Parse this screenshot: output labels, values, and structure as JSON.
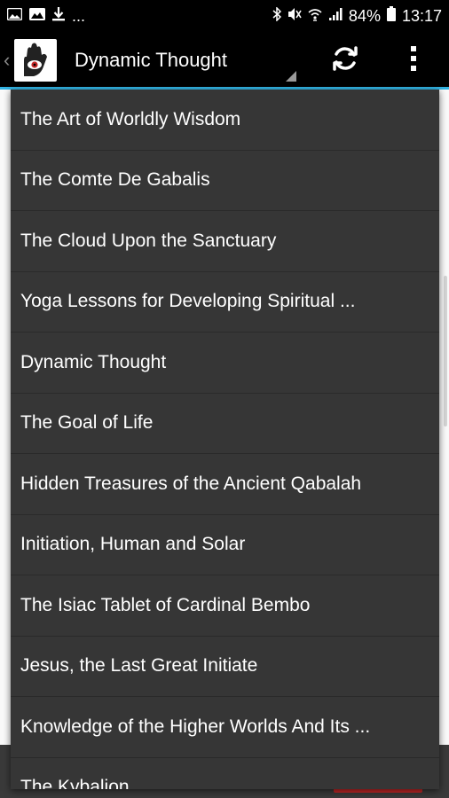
{
  "status_bar": {
    "battery_percent": "84%",
    "time": "13:17",
    "overflow_indicator": "...",
    "left_icons": [
      "image-icon",
      "gallery-icon",
      "download-icon"
    ],
    "right_icons": [
      "bluetooth-icon",
      "mute-icon",
      "wifi-icon",
      "signal-icon",
      "battery-icon"
    ]
  },
  "action_bar": {
    "spinner_selected": "Dynamic Thought",
    "refresh_icon": "refresh-icon",
    "overflow_icon": "overflow-menu-icon",
    "accent_color": "#33b5e5"
  },
  "dropdown": {
    "items": [
      "The Art of Worldly Wisdom",
      "The Comte De Gabalis",
      "The Cloud Upon the Sanctuary",
      "Yoga Lessons for Developing Spiritual ...",
      "Dynamic Thought",
      "The Goal of Life",
      "Hidden Treasures of the Ancient Qabalah",
      "Initiation, Human and Solar",
      "The Isiac Tablet of Cardinal Bembo",
      "Jesus, the Last Great Initiate",
      "Knowledge of the Higher Worlds And Its ...",
      "The Kybalion"
    ]
  }
}
